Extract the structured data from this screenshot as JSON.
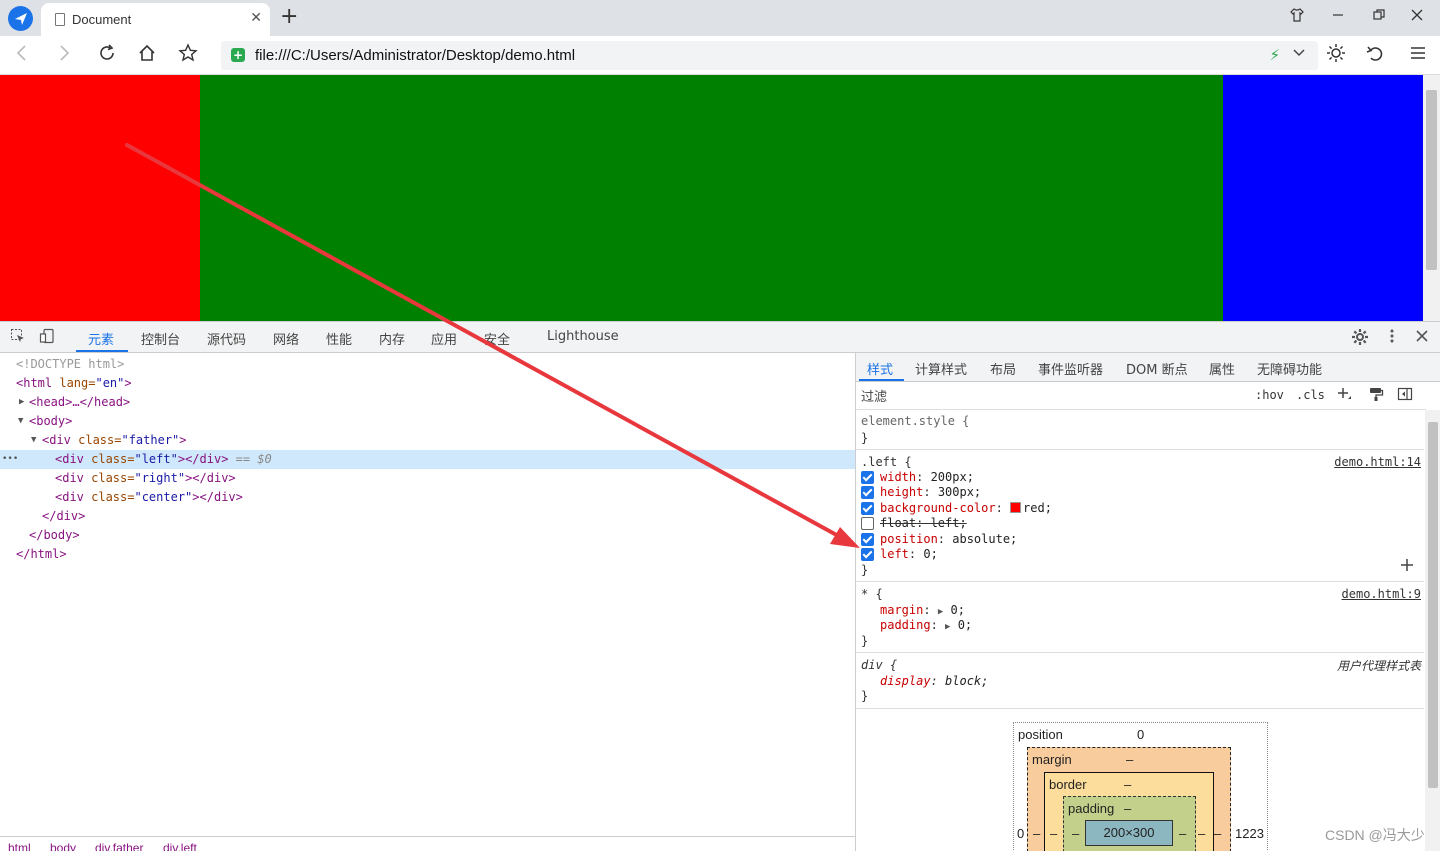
{
  "browser": {
    "tab_title": "Document",
    "tab_close": "✕",
    "new_tab": "+",
    "address": "file:///C:/Users/Administrator/Desktop/demo.html"
  },
  "page_colors": {
    "left": "#ff0000",
    "center": "#008000",
    "right": "#0000ff"
  },
  "devtools": {
    "tabs": [
      "元素",
      "控制台",
      "源代码",
      "网络",
      "性能",
      "内存",
      "应用",
      "安全",
      "Lighthouse"
    ],
    "active_tab": "元素"
  },
  "dom": {
    "doctype": "<!DOCTYPE html>",
    "html_open_tag": "<html",
    "html_attr": " lang=",
    "html_val": "\"en\"",
    "head": "<head>…</head>",
    "body_open": "<body>",
    "div_open": "<div",
    "class_attr": " class=",
    "father_val": "\"father\"",
    "left_val": "\"left\"",
    "right_val": "\"right\"",
    "center_val": "\"center\"",
    "div_close": "</div>",
    "gt": ">",
    "selected_marker": " == $0",
    "dots": "•••",
    "body_close": "</body>",
    "html_close": "</html>"
  },
  "breadcrumbs": [
    "html",
    "body",
    "div.father",
    "div.left"
  ],
  "styles_pane": {
    "tabs": [
      "样式",
      "计算样式",
      "布局",
      "事件监听器",
      "DOM 断点",
      "属性",
      "无障碍功能"
    ],
    "filter_placeholder": "过滤",
    "hov": ":hov",
    "cls": ".cls",
    "element_style_selector": "element.style {",
    "close_brace": "}",
    "left_rule": {
      "selector": ".left {",
      "source": "demo.html:14",
      "props": [
        {
          "name": "width",
          "value": "200px;",
          "enabled": true
        },
        {
          "name": "height",
          "value": "300px;",
          "enabled": true
        },
        {
          "name": "background-color",
          "value": "red;",
          "enabled": true,
          "swatch": "#ff0000"
        },
        {
          "name": "float",
          "value": "left;",
          "enabled": false
        },
        {
          "name": "position",
          "value": "absolute;",
          "enabled": true
        },
        {
          "name": "left",
          "value": "0;",
          "enabled": true
        }
      ]
    },
    "star_rule": {
      "selector": "* {",
      "source": "demo.html:9",
      "props": [
        {
          "name": "margin",
          "value": "0;"
        },
        {
          "name": "padding",
          "value": "0;"
        }
      ]
    },
    "div_rule": {
      "selector": "div {",
      "source": "用户代理样式表",
      "props": [
        {
          "name": "display",
          "value": "block;"
        }
      ]
    }
  },
  "box_model": {
    "position_label": "position",
    "position_top": "0",
    "position_left": "0",
    "position_right": "1223",
    "margin_label": "margin",
    "border_label": "border",
    "padding_label": "padding",
    "dash": "–",
    "content_size": "200×300"
  },
  "watermark": "CSDN @冯大少",
  "annotation_color": "#e8383d"
}
